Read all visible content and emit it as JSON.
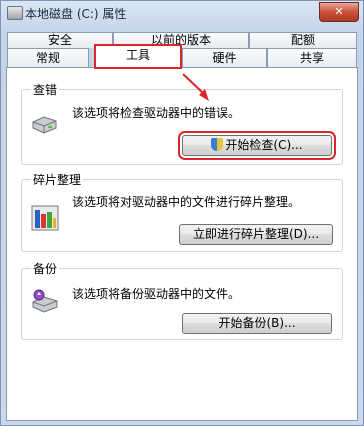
{
  "window": {
    "title": "本地磁盘 (C:) 属性",
    "close_label": "✕"
  },
  "tabs": {
    "back_row": [
      "安全",
      "以前的版本",
      "配额"
    ],
    "front_row": [
      "常规",
      "工具",
      "硬件",
      "共享"
    ],
    "active": "工具"
  },
  "groups": {
    "check": {
      "label": "查错",
      "description": "该选项将检查驱动器中的错误。",
      "button": "开始检查(C)...",
      "icon": "drive-icon"
    },
    "defrag": {
      "label": "碎片整理",
      "description": "该选项将对驱动器中的文件进行碎片整理。",
      "button": "立即进行碎片整理(D)...",
      "icon": "defrag-icon"
    },
    "backup": {
      "label": "备份",
      "description": "该选项将备份驱动器中的文件。",
      "button": "开始备份(B)...",
      "icon": "backup-icon"
    }
  },
  "colors": {
    "annotation": "#d9262a",
    "accent": "#3a7bd5"
  }
}
